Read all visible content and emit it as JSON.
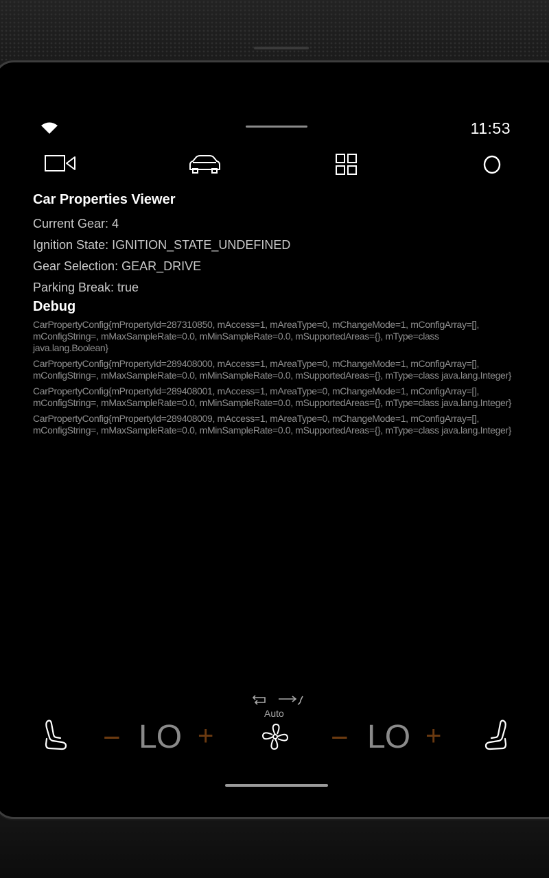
{
  "status_bar": {
    "time": "11:53",
    "wifi_icon": "wifi-icon"
  },
  "app_bar": {
    "icons": [
      "video-camera-icon",
      "car-icon",
      "apps-grid-icon",
      "circle-icon"
    ]
  },
  "content": {
    "title": "Car Properties Viewer",
    "properties": [
      "Current Gear: 4",
      "Ignition State: IGNITION_STATE_UNDEFINED",
      "Gear Selection: GEAR_DRIVE",
      "Parking Break: true"
    ],
    "debug_title": "Debug",
    "debug_entries": [
      "CarPropertyConfig{mPropertyId=287310850, mAccess=1, mAreaType=0, mChangeMode=1, mConfigArray=[], mConfigString=, mMaxSampleRate=0.0, mMinSampleRate=0.0, mSupportedAreas={}, mType=class java.lang.Boolean}",
      "CarPropertyConfig{mPropertyId=289408000, mAccess=1, mAreaType=0, mChangeMode=1, mConfigArray=[], mConfigString=, mMaxSampleRate=0.0, mMinSampleRate=0.0, mSupportedAreas={}, mType=class java.lang.Integer}",
      "CarPropertyConfig{mPropertyId=289408001, mAccess=1, mAreaType=0, mChangeMode=1, mConfigArray=[], mConfigString=, mMaxSampleRate=0.0, mMinSampleRate=0.0, mSupportedAreas={}, mType=class java.lang.Integer}",
      "CarPropertyConfig{mPropertyId=289408009, mAccess=1, mAreaType=0, mChangeMode=1, mConfigArray=[], mConfigString=, mMaxSampleRate=0.0, mMinSampleRate=0.0, mSupportedAreas={}, mType=class java.lang.Integer}"
    ]
  },
  "climate": {
    "left_temp": "LO",
    "right_temp": "LO",
    "minus_label": "−",
    "plus_label": "+",
    "fan_mode": "Auto",
    "accent_color": "#6b3a10"
  }
}
